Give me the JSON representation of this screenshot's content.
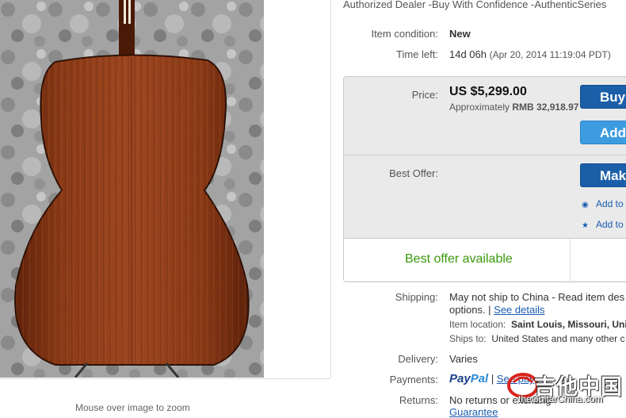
{
  "seller_note": "Authorized Dealer -Buy With Confidence -AuthenticSeries",
  "condition": {
    "label": "Item condition:",
    "value": "New"
  },
  "time_left": {
    "label": "Time left:",
    "value": "14d 06h",
    "end": "(Apr 20, 2014  11:19:04 PDT)"
  },
  "price": {
    "label": "Price:",
    "value": "US $5,299.00",
    "approx_prefix": "Approximately",
    "approx_value": "RMB 32,918.97"
  },
  "buttons": {
    "buy": "Buy",
    "add": "Add",
    "make": "Make"
  },
  "best_offer": {
    "label": "Best Offer:",
    "available": "Best offer available"
  },
  "watch_links": [
    {
      "icon": "eye-icon",
      "label": "Add to"
    },
    {
      "icon": "star-icon",
      "label": "Add to"
    }
  ],
  "shipping": {
    "label": "Shipping:",
    "line1": "May not ship to China - Read item des",
    "line2": "options.",
    "see_details": "See details",
    "location_label": "Item location:",
    "location_value": "Saint Louis, Missouri, Unit",
    "ships_label": "Ships to:",
    "ships_value": "United States and many other c"
  },
  "delivery": {
    "label": "Delivery:",
    "value": "Varies"
  },
  "payments": {
    "label": "Payments:",
    "paypal_a": "Pay",
    "paypal_b": "Pal",
    "sep": "|",
    "see_more": "See pay"
  },
  "returns": {
    "label": "Returns:",
    "value": "No returns or exchang",
    "guarantee": "Guarantee"
  },
  "image_hint": "Mouse over image to zoom",
  "watermark": {
    "text": "吉他中国",
    "url": "theGuitarChina.com"
  }
}
